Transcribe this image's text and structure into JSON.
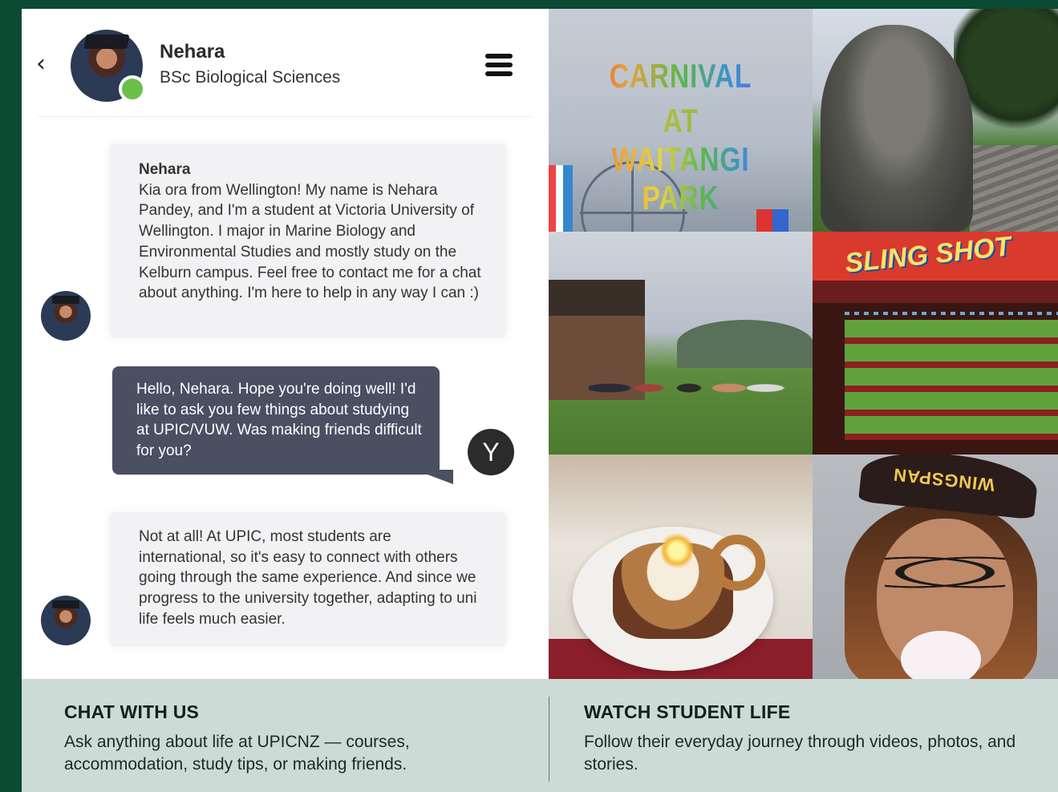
{
  "header": {
    "back_icon": "chevron-left-icon",
    "name": "Nehara",
    "subtitle": "BSc Biological Sciences",
    "status_color": "#6cc04a",
    "menu_icon": "hamburger-menu-icon"
  },
  "messages": [
    {
      "sender": "Nehara",
      "text": "Kia ora from Wellington! My name is Nehara Pandey, and I'm a student at Victoria University of Wellington. I major in Marine Biology and Environmental Studies and mostly study on the Kelburn campus. Feel free to contact me for a chat about anything. I'm here to help in any way I can :)"
    },
    {
      "sender": "",
      "text": "Hello, Nehara. Hope you're doing well! I'd like to ask you few things about studying at UPIC/VUW. Was making friends difficult for you?",
      "avatar_initial": "Y"
    },
    {
      "sender": "",
      "text": "Not at all! At UPIC, most students are international, so it's easy to connect with others going through the same experience. And since we progress to the university together, adapting to uni life feels much easier."
    }
  ],
  "photos": {
    "carnival_lines": [
      "CARNIVAL",
      "AT",
      "WAITANGI PARK"
    ],
    "slingshot_sign": "SLING SHOT",
    "cap_text": "WINGSPAN"
  },
  "footer": {
    "chat": {
      "title": "CHAT WITH US",
      "desc": "Ask anything about life at UPICNZ — courses, accommodation, study tips, or making friends."
    },
    "watch": {
      "title": "WATCH STUDENT LIFE",
      "desc": "Follow their everyday journey through videos, photos, and stories."
    }
  },
  "colors": {
    "brand_green": "#0b4a33",
    "footer_bg": "#ccdbd5",
    "outgoing_bubble": "#4a4f62",
    "incoming_bubble": "#f2f2f4"
  }
}
